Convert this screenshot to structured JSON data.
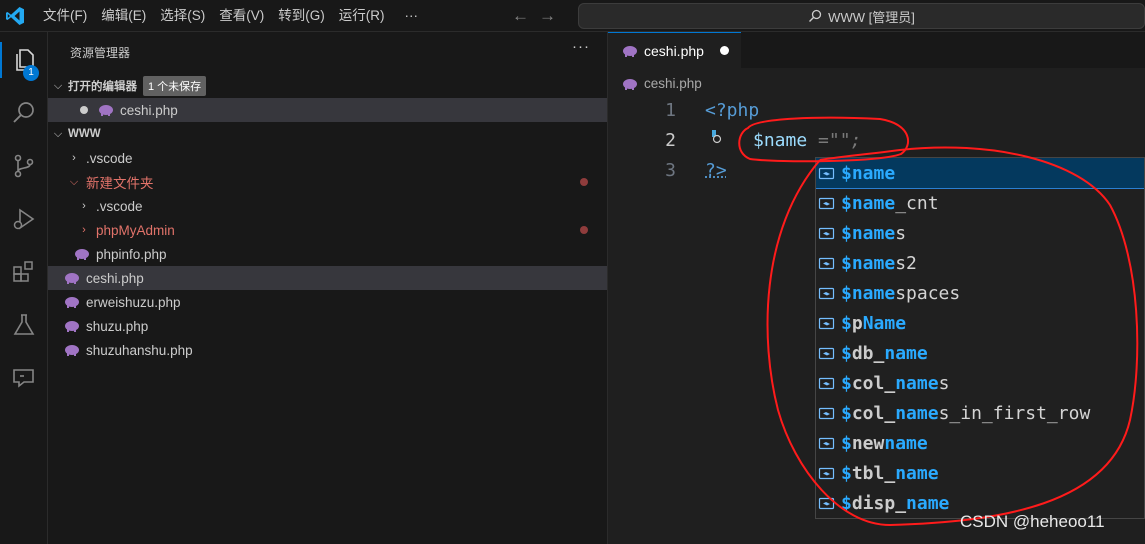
{
  "menu": {
    "items": [
      "文件(F)",
      "编辑(E)",
      "选择(S)",
      "查看(V)",
      "转到(G)",
      "运行(R)",
      "···"
    ],
    "search_text": "WWW [管理员]"
  },
  "activity": {
    "explorer_badge": "1"
  },
  "sidebar": {
    "title": "资源管理器",
    "more": "···",
    "open_editors": {
      "label": "打开的编辑器",
      "badge": "1 个未保存",
      "file": "ceshi.php"
    },
    "root": "WWW",
    "tree": [
      {
        "label": ".vscode",
        "kind": "folder",
        "indent": 1
      },
      {
        "label": "新建文件夹",
        "kind": "folder-open-git",
        "indent": 1
      },
      {
        "label": ".vscode",
        "kind": "folder",
        "indent": 2
      },
      {
        "label": "phpMyAdmin",
        "kind": "folder-git",
        "indent": 2
      },
      {
        "label": "phpinfo.php",
        "kind": "php",
        "indent": 2
      },
      {
        "label": "ceshi.php",
        "kind": "php",
        "indent": 1,
        "selected": true
      },
      {
        "label": "erweishuzu.php",
        "kind": "php",
        "indent": 1
      },
      {
        "label": "shuzu.php",
        "kind": "php",
        "indent": 1
      },
      {
        "label": "shuzuhanshu.php",
        "kind": "php",
        "indent": 1
      }
    ]
  },
  "editor": {
    "tab_label": "ceshi.php",
    "breadcrumb": "ceshi.php",
    "lines": [
      {
        "number": "1",
        "text": "<?php"
      },
      {
        "number": "2",
        "text": "$name",
        "ghost": " =\"\";"
      },
      {
        "number": "3",
        "text": "?>"
      }
    ]
  },
  "suggestions": [
    {
      "label": "$name",
      "match": "$name",
      "rest": ""
    },
    {
      "label": "$name_cnt",
      "match": "$name",
      "rest": "_cnt"
    },
    {
      "label": "$names",
      "match": "$name",
      "rest": "s"
    },
    {
      "label": "$names2",
      "match": "$name",
      "rest": "s2"
    },
    {
      "label": "$namespaces",
      "match": "$name",
      "rest": "spaces"
    },
    {
      "label": "$pName",
      "match": "$",
      "mid": "p",
      "match2": "Name",
      "rest": ""
    },
    {
      "label": "$db_name",
      "match": "$",
      "mid": "db_",
      "match2": "name",
      "rest": ""
    },
    {
      "label": "$col_names",
      "match": "$",
      "mid": "col_",
      "match2": "name",
      "rest": "s"
    },
    {
      "label": "$col_names_in_first_row",
      "match": "$",
      "mid": "col_",
      "match2": "name",
      "rest": "s_in_first_row"
    },
    {
      "label": "$newname",
      "match": "$",
      "mid": "new",
      "match2": "name",
      "rest": ""
    },
    {
      "label": "$tbl_name",
      "match": "$",
      "mid": "tbl_",
      "match2": "name",
      "rest": ""
    },
    {
      "label": "$disp_name",
      "match": "$",
      "mid": "disp_",
      "match2": "name",
      "rest": ""
    }
  ],
  "watermark": "CSDN @heheoo11"
}
